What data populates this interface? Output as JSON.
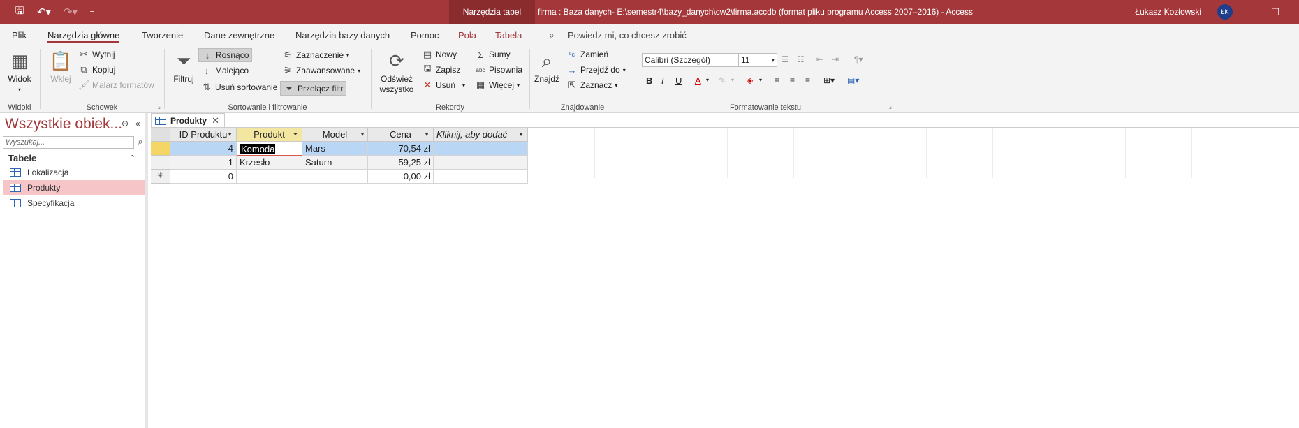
{
  "titlebar": {
    "context_tools": "Narzędzia tabel",
    "title": "firma : Baza danych- E:\\semestr4\\bazy_danych\\cw2\\firma.accdb (format pliku programu Access 2007–2016)  -  Access",
    "user": "Łukasz Kozłowski",
    "initials": "ŁK"
  },
  "tabs": [
    "Plik",
    "Narzędzia główne",
    "Tworzenie",
    "Dane zewnętrzne",
    "Narzędzia bazy danych",
    "Pomoc",
    "Pola",
    "Tabela"
  ],
  "tell_me": "Powiedz mi, co chcesz zrobić",
  "ribbon": {
    "widoki": {
      "label": "Widoki",
      "widok": "Widok"
    },
    "schowek": {
      "label": "Schowek",
      "wklej": "Wklej",
      "wytnij": "Wytnij",
      "kopiuj": "Kopiuj",
      "malarz": "Malarz formatów"
    },
    "sort": {
      "label": "Sortowanie i filtrowanie",
      "filtruj": "Filtruj",
      "rosnaco": "Rosnąco",
      "malejaco": "Malejąco",
      "usun_sort": "Usuń sortowanie",
      "zaznaczenie": "Zaznaczenie",
      "zaawansowane": "Zaawansowane",
      "przelacz": "Przełącz filtr"
    },
    "rekordy": {
      "label": "Rekordy",
      "odswiez1": "Odśwież",
      "odswiez2": "wszystko",
      "nowy": "Nowy",
      "zapisz": "Zapisz",
      "usun": "Usuń",
      "sumy": "Sumy",
      "pisownia": "Pisownia",
      "wiecej": "Więcej"
    },
    "znajdowanie": {
      "label": "Znajdowanie",
      "znajdz": "Znajdź",
      "zamien": "Zamień",
      "przejdz": "Przejdź do",
      "zaznacz": "Zaznacz"
    },
    "format": {
      "label": "Formatowanie tekstu",
      "font": "Calibri (Szczegół)",
      "size": "11"
    }
  },
  "nav": {
    "title": "Wszystkie obiek...",
    "search_placeholder": "Wyszukaj...",
    "section": "Tabele",
    "items": [
      "Lokalizacja",
      "Produkty",
      "Specyfikacja"
    ]
  },
  "doc_tab": "Produkty",
  "table": {
    "columns": [
      "ID Produktu",
      "Produkt",
      "Model",
      "Cena",
      "Kliknij, aby dodać"
    ],
    "rows": [
      {
        "id": "4",
        "produkt": "Komoda",
        "model": "Mars",
        "cena": "70,54 zł"
      },
      {
        "id": "1",
        "produkt": "Krzesło",
        "model": "Saturn",
        "cena": "59,25 zł"
      },
      {
        "id": "0",
        "produkt": "",
        "model": "",
        "cena": "0,00 zł"
      }
    ]
  },
  "colors": {
    "accent": "#a4373a",
    "selection": "#b9d7f5",
    "nav_selected": "#f6c5c8"
  }
}
